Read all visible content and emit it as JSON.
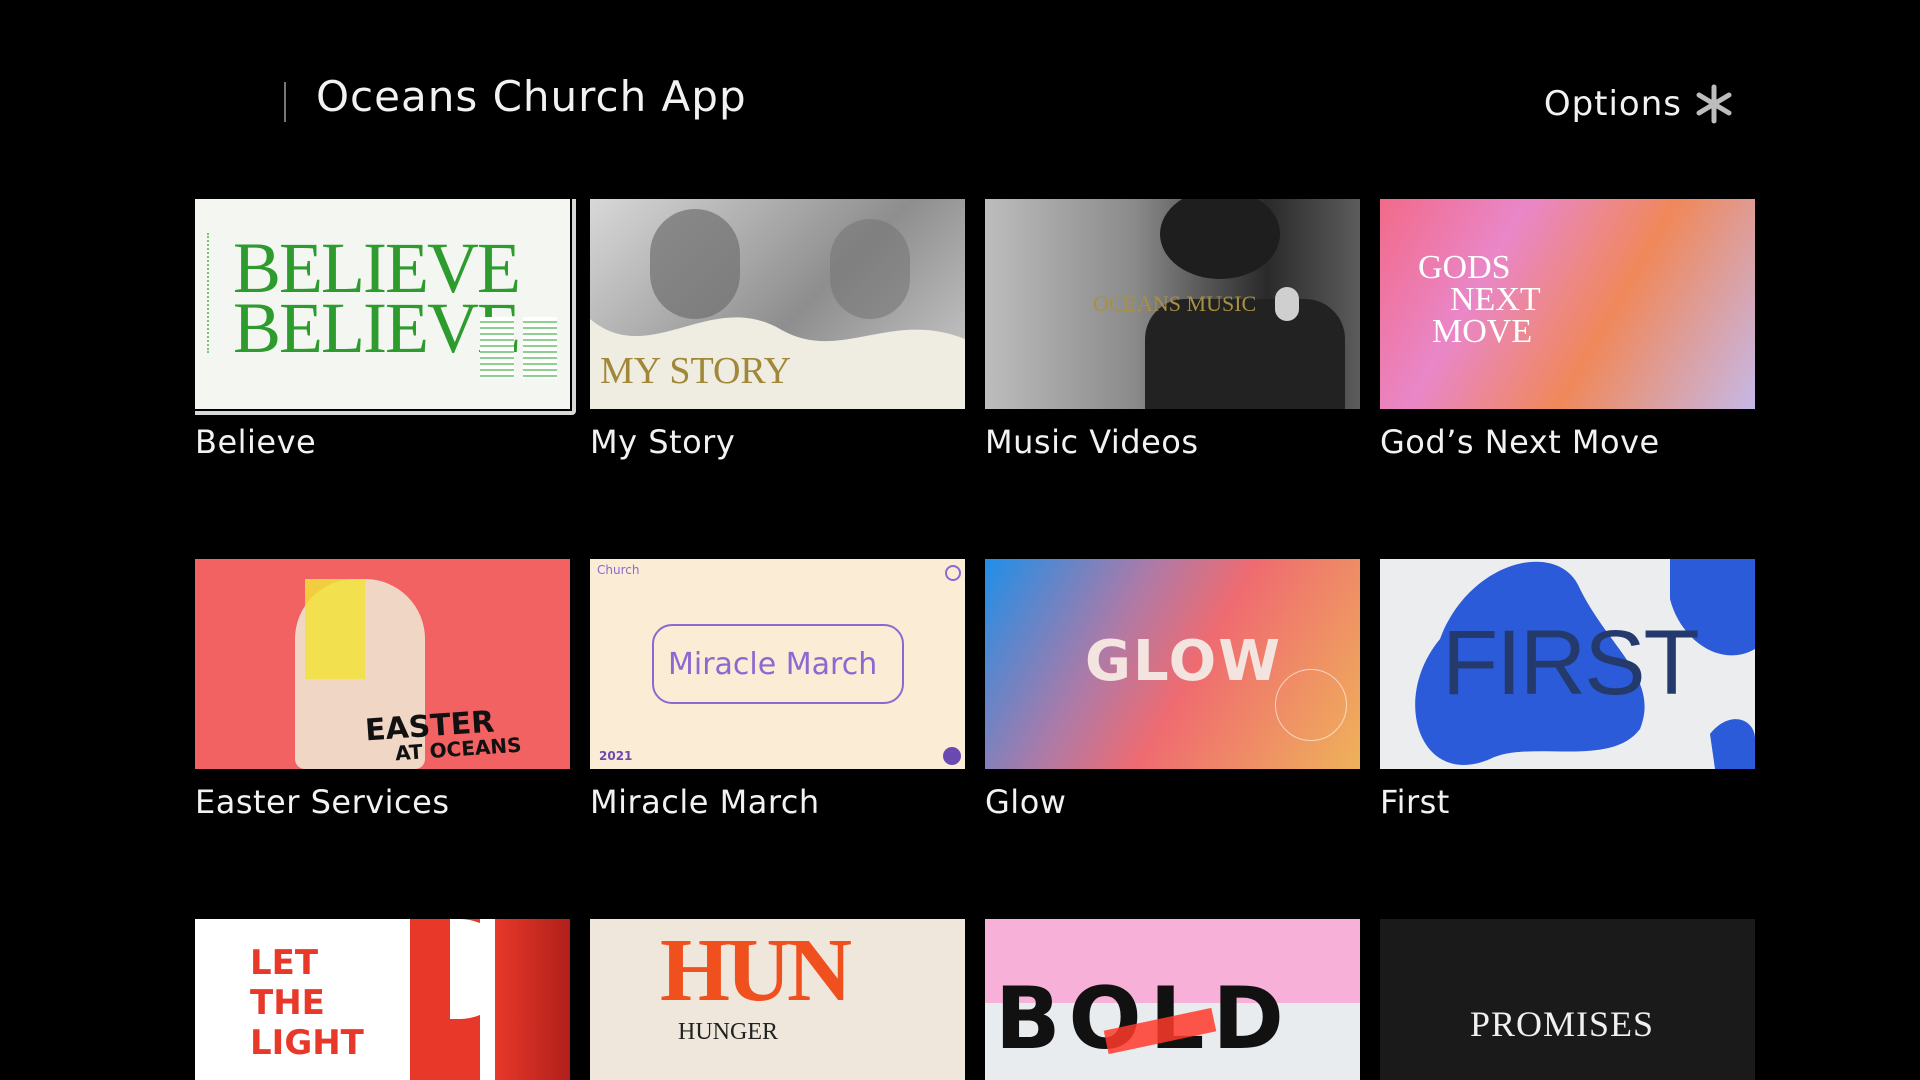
{
  "header": {
    "title": "Oceans Church App",
    "options_label": "Options",
    "options_icon": "asterisk-icon"
  },
  "tiles": [
    {
      "label": "Believe",
      "art_text": "BELIEVE",
      "art_text2": "BELIEVE",
      "focused": true
    },
    {
      "label": "My Story",
      "art_text": "MY STORY"
    },
    {
      "label": "Music Videos",
      "art_text": "OCEANS MUSIC"
    },
    {
      "label": "God’s Next Move",
      "art_text": "GODS",
      "art_text2": "NEXT",
      "art_text3": "MOVE"
    },
    {
      "label": "Easter Services",
      "art_text": "EASTER",
      "art_text2": "AT OCEANS"
    },
    {
      "label": "Miracle March",
      "art_text": "Miracle March",
      "art_small": "Church",
      "art_year": "2021"
    },
    {
      "label": "Glow",
      "art_text": "GLOW"
    },
    {
      "label": "First",
      "art_text": "FIRST"
    },
    {
      "label": "",
      "art_text": "LET",
      "art_text2": "THE",
      "art_text3": "LIGHT"
    },
    {
      "label": "",
      "art_text": "HUN",
      "art_text2": "HUNGER"
    },
    {
      "label": "",
      "art_text": "BOLD"
    },
    {
      "label": "",
      "art_text": "PROMISES"
    }
  ],
  "colors": {
    "background": "#000000",
    "focus_ring": "#d8d8d8",
    "believe_green": "#2e9b2e",
    "mystory_gold": "#a08838",
    "miracle_purple": "#8a6ad0",
    "first_blue": "#2b5bd8",
    "light_red": "#e8382a",
    "hunger_orange": "#f0501e"
  }
}
